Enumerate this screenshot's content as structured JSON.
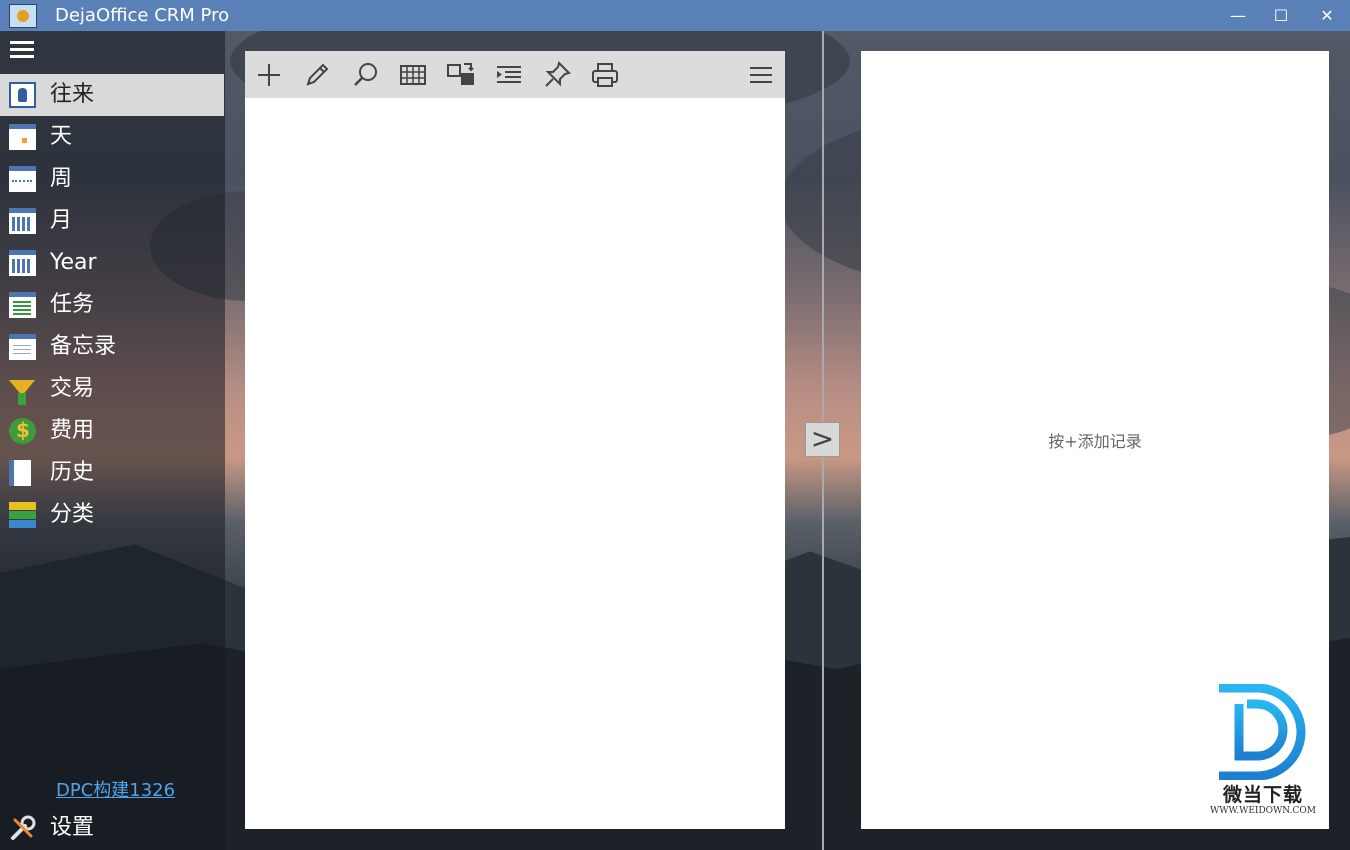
{
  "window": {
    "title": "DejaOffice CRM Pro",
    "minimize": "—",
    "maximize": "☐",
    "close": "✕"
  },
  "sidebar": {
    "items": [
      {
        "label": "往来",
        "icon": "contact-card-icon",
        "selected": true
      },
      {
        "label": "天",
        "icon": "calendar-day-icon"
      },
      {
        "label": "周",
        "icon": "calendar-week-icon"
      },
      {
        "label": "月",
        "icon": "calendar-month-icon"
      },
      {
        "label": "Year",
        "icon": "calendar-year-icon"
      },
      {
        "label": "任务",
        "icon": "task-list-icon"
      },
      {
        "label": "备忘录",
        "icon": "memo-icon"
      },
      {
        "label": "交易",
        "icon": "funnel-icon"
      },
      {
        "label": "费用",
        "icon": "money-icon"
      },
      {
        "label": "历史",
        "icon": "history-book-icon"
      },
      {
        "label": "分类",
        "icon": "category-icon"
      }
    ],
    "build_link": "DPC构建1326",
    "settings_label": "设置"
  },
  "toolbar": {
    "icons": [
      "add-icon",
      "edit-icon",
      "search-icon",
      "grid-view-icon",
      "sync-icon",
      "indent-icon",
      "pin-icon",
      "print-icon",
      "menu-icon"
    ]
  },
  "splitter": {
    "expand_label": ">"
  },
  "detail": {
    "hint": "按+添加记录"
  },
  "watermark": {
    "text": "微当下载",
    "sub": "WWW.WEIDOWN.COM"
  },
  "colors": {
    "titlebar": "#5a80b8",
    "selected_item": "#d9d9d9",
    "link": "#4fa3e8",
    "toolbar": "#dcdcdc"
  }
}
